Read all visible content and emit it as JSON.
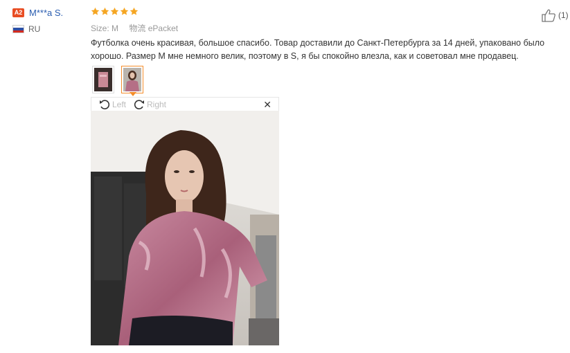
{
  "reviewer": {
    "badge": "A2",
    "name": "M***a S.",
    "country_code": "RU",
    "flag_colors": [
      "#ffffff",
      "#2c4fa6",
      "#d52b1e"
    ]
  },
  "rating": {
    "stars": 5,
    "max": 5,
    "color": "#f5a623"
  },
  "attributes": {
    "size_label": "Size:",
    "size_value": "M",
    "shipping_label": "物流",
    "shipping_value": "ePacket"
  },
  "review_text": "Футболка очень красивая, большое спасибо. Товар доставили до Санкт-Петербурга за 14 дней, упаковано было хорошо. Размер M мне немного велик, поэтому в S, я бы спокойно влезла, как и советовал мне продавец.",
  "images": {
    "thumbnail_count": 2,
    "active_index": 1
  },
  "viewer": {
    "rotate_left_label": "Left",
    "rotate_right_label": "Right",
    "close_icon": "close-icon"
  },
  "helpful": {
    "count_text": "(1)",
    "icon": "thumbs-up-icon"
  },
  "colors": {
    "accent": "#f48c2a",
    "link": "#2a5db0",
    "badge": "#e84d23"
  }
}
